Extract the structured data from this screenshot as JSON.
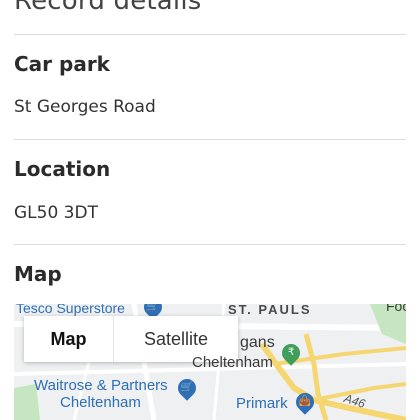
{
  "page": {
    "title": "Record details"
  },
  "fields": [
    {
      "label": "Car park",
      "value": "St Georges Road"
    },
    {
      "label": "Location",
      "value": "GL50 3DT"
    }
  ],
  "map_section": {
    "label": "Map",
    "toggle": {
      "map_label": "Map",
      "satellite_label": "Satellite",
      "selected": "Map"
    },
    "labels": {
      "tesco": "Tesco Superstore",
      "st_pauls": "ST. PAULS",
      "top_right": "Foo",
      "gans": "gans",
      "cheltenham_center": "Cheltenham",
      "waitrose": "Waitrose & Partners",
      "waitrose_sub": "Cheltenham",
      "primark": "Primark",
      "road": "A46"
    },
    "colors": {
      "map_bg": "#eef0f1",
      "road_yellow": "#f6d670",
      "park_green": "#c6e6c1",
      "poi_blue": "#2f6fb5",
      "poi_green": "#3e9e5a"
    }
  }
}
